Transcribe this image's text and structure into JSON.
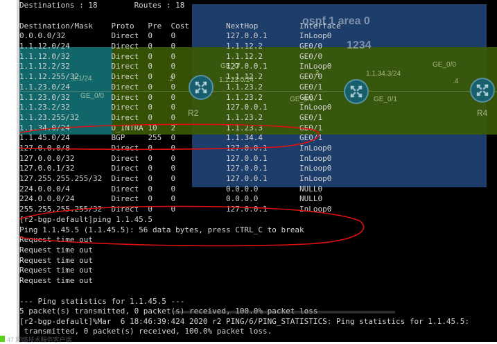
{
  "terminal": {
    "lines": [
      "Destinations : 18        Routes : 18",
      "",
      "Destination/Mask    Proto   Pre  Cost        NextHop         Interface",
      "0.0.0.0/32          Direct  0    0           127.0.0.1       InLoop0",
      "1.1.12.0/24         Direct  0    0           1.1.12.2        GE0/0",
      "1.1.12.0/32         Direct  0    0           1.1.12.2        GE0/0",
      "1.1.12.2/32         Direct  0    0           127.0.0.1       InLoop0",
      "1.1.12.255/32       Direct  0    0           1.1.12.2        GE0/0",
      "1.1.23.0/24         Direct  0    0           1.1.23.2        GE0/1",
      "1.1.23.0/32         Direct  0    0           1.1.23.2        GE0/1",
      "1.1.23.2/32         Direct  0    0           127.0.0.1       InLoop0",
      "1.1.23.255/32       Direct  0    0           1.1.23.2        GE0/1",
      "1.1.34.0/24         O_INTRA 10   2           1.1.23.3        GE0/1",
      "1.1.45.0/24         BGP     255  0           1.1.34.4        GE0/1",
      "127.0.0.0/8         Direct  0    0           127.0.0.1       InLoop0",
      "127.0.0.0/32        Direct  0    0           127.0.0.1       InLoop0",
      "127.0.0.1/32        Direct  0    0           127.0.0.1       InLoop0",
      "127.255.255.255/32  Direct  0    0           127.0.0.1       InLoop0",
      "224.0.0.0/4         Direct  0    0           0.0.0.0         NULL0",
      "224.0.0.0/24        Direct  0    0           0.0.0.0         NULL0",
      "255.255.255.255/32  Direct  0    0           127.0.0.1       InLoop0",
      "[r2-bgp-default]ping 1.1.45.5",
      "Ping 1.1.45.5 (1.1.45.5): 56 data bytes, press CTRL_C to break",
      "Request time out",
      "Request time out",
      "Request time out",
      "Request time out",
      "Request time out",
      "",
      "--- Ping statistics for 1.1.45.5 ---",
      "5 packet(s) transmitted, 0 packet(s) received, 100.0% packet loss",
      "[r2-bgp-default]%Mar  6 18:46:39:424 2020 r2 PING/6/PING_STATISTICS: Ping statistics for 1.1.45.5:",
      " transmitted, 0 packet(s) received, 100.0% packet loss."
    ]
  },
  "topology": {
    "area0_title": "ospf 1 area 0",
    "area_number": "1234",
    "labels": [
      {
        "id": "ge00-a",
        "text": "GE_0/"
      },
      {
        "id": "addr-a",
        "text": ".2.1/24"
      },
      {
        "id": "dot2",
        "text": ".2"
      },
      {
        "id": "ge00-b",
        "text": "GE_0/0"
      },
      {
        "id": "addr-b",
        "text": "1.1.23.0/24"
      },
      {
        "id": "dot3",
        "text": ".3"
      },
      {
        "id": "addr-c",
        "text": "1.1.34.3/24"
      },
      {
        "id": "ge00-c",
        "text": "GE_0/0"
      },
      {
        "id": "ge00-d",
        "text": "GE_0/0"
      },
      {
        "id": "ge01",
        "text": "GE_0/1"
      },
      {
        "id": "dot4",
        "text": ".4"
      }
    ],
    "router_labels": {
      "r2": "R2",
      "r4": "R4"
    }
  },
  "watermark": "47 网络技术服务客户端",
  "colors": {
    "terminal_bg": "#000000",
    "terminal_text": "#d4d4d4",
    "annotation_red": "#e01010",
    "area0_blue": "#21457a",
    "area_green": "#3a5806",
    "area_cyan": "#0e6872"
  }
}
